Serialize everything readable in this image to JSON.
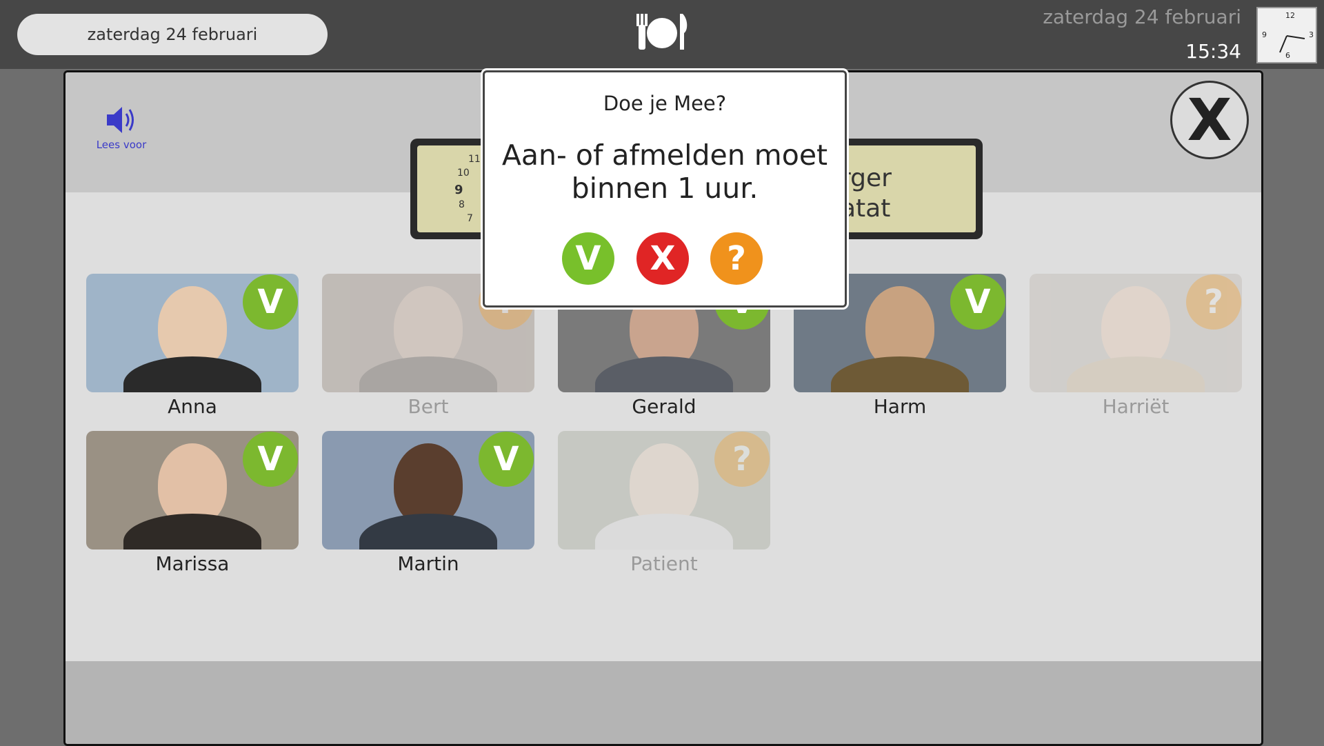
{
  "topbar": {
    "date_pill": "zaterdag 24 februari",
    "date": "zaterdag 24 februari",
    "time": "15:34"
  },
  "header": {
    "read_aloud_label": "Lees voor",
    "close_label": "X"
  },
  "activity_cards": {
    "left_clock_numbers": [
      "11",
      "10",
      "9",
      "8",
      "7"
    ],
    "right_title_lines": [
      "rger",
      "atat"
    ]
  },
  "dialog": {
    "title": "Doe je Mee?",
    "message": "Aan- of afmelden moet binnen 1 uur.",
    "buttons": {
      "yes": "V",
      "no": "X",
      "maybe": "?"
    }
  },
  "people": [
    {
      "name": "Anna",
      "status": "V",
      "state": "yes",
      "dimmed": false
    },
    {
      "name": "Bert",
      "status": "?",
      "state": "maybe",
      "dimmed": true
    },
    {
      "name": "Gerald",
      "status": "V",
      "state": "yes",
      "dimmed": false
    },
    {
      "name": "Harm",
      "status": "V",
      "state": "yes",
      "dimmed": false
    },
    {
      "name": "Harriët",
      "status": "?",
      "state": "maybe",
      "dimmed": true
    },
    {
      "name": "Marissa",
      "status": "V",
      "state": "yes",
      "dimmed": false
    },
    {
      "name": "Martin",
      "status": "V",
      "state": "yes",
      "dimmed": false
    },
    {
      "name": "Patient",
      "status": "?",
      "state": "maybe",
      "dimmed": true
    }
  ],
  "colors": {
    "yes": "#78c02b",
    "no": "#e02525",
    "maybe": "#f0921c",
    "topbar": "#474747"
  },
  "icons": {
    "dining": "plate-cutlery-icon",
    "clock": "analog-clock-icon",
    "speaker": "speaker-icon"
  }
}
